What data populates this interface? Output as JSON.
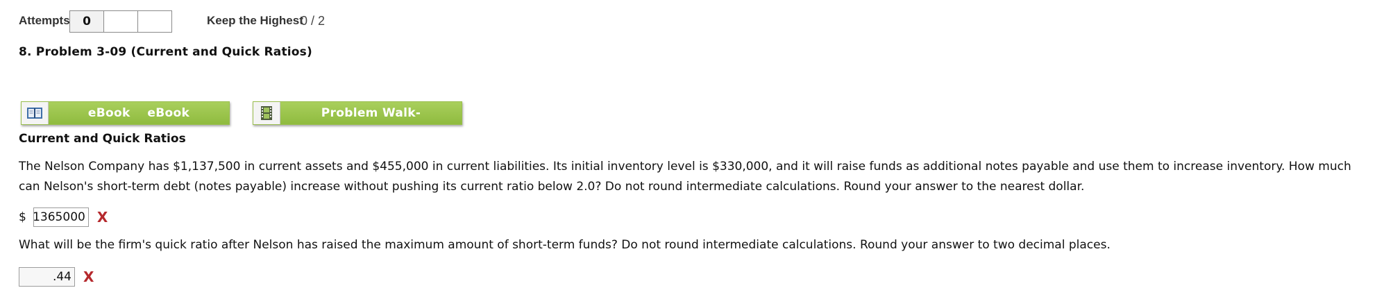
{
  "attempts": {
    "label": "Attempts",
    "boxes": [
      "0",
      "",
      ""
    ],
    "keep_label": "Keep the Highest",
    "score": "0 / 2"
  },
  "problem": {
    "title": "8.  Problem 3-09 (Current and Quick Ratios)"
  },
  "buttons": {
    "ebook_label": "eBook    eBook",
    "walk_label": "Problem Walk-"
  },
  "content": {
    "section_title": "Current and Quick Ratios",
    "paragraph": "The Nelson Company has $1,137,500 in current assets and $455,000 in current liabilities. Its initial inventory level is $330,000, and it will raise funds as additional notes payable and use them to increase inventory. How much can Nelson's short-term debt (notes payable) increase without pushing its current ratio below 2.0? Do not round intermediate calculations. Round your answer to the nearest dollar.",
    "answer1_prefix": "$",
    "answer1_value": "1365000",
    "answer1_mark": "X",
    "question2": "What will be the firm's quick ratio after Nelson has raised the maximum amount of short-term funds? Do not round intermediate calculations. Round your answer to two decimal places.",
    "answer2_value": ".44",
    "answer2_mark": "X"
  },
  "colors": {
    "button_green": "#97c248",
    "wrong_mark": "#b5292d"
  },
  "icons": {
    "ebook": "open-book-icon",
    "walk": "film-strip-icon"
  }
}
